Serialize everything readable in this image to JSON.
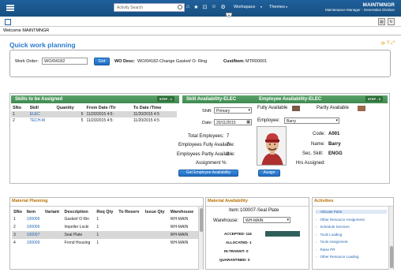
{
  "topbar": {
    "search_placeholder": "Activity Search",
    "nav_workspace": "Workspace",
    "nav_themes": "Themes",
    "user_name": "MAINTMNGR",
    "user_role": "Maintenance Manager - Generation Division"
  },
  "welcome": "Welcome MAINTMNGR",
  "page_title": "Quick work planning",
  "work_order": {
    "label": "Work Order:",
    "value": "WO/04182",
    "get_label": "Get",
    "desc_label": "WO Desc:",
    "desc_value": "WO/04182-Change Gasket/ O- Ring",
    "cust_label": "Cust/Item:",
    "cust_value": "MTR00001"
  },
  "skills": {
    "title": "Skills to be Assigned",
    "step": "STEP - 1",
    "columns": [
      "SNo",
      "Skill",
      "Quantity",
      "From Date /Tir",
      "To Date /Time"
    ],
    "rows": [
      [
        "1",
        "ELEC",
        "5",
        "11/20/2015 4:5:",
        "11/20/2015 4:5"
      ],
      [
        "2",
        "TECH-M",
        "5",
        "11/20/2015 4:5:",
        "11/20/2015 4:5"
      ]
    ]
  },
  "availability": {
    "title": "Skill Availability-ELEC",
    "step": "STEP - 2",
    "shift_label": "Shift:",
    "shift_value": "Primary",
    "date_label": "Date:",
    "date_value": "20/11/2015",
    "total_label": "Total Employees:",
    "total_value": "7",
    "full_label": "Employees Fully Available:",
    "full_value": "7",
    "partly_label": "Employees Partly Available:",
    "partly_value": "0",
    "assign_pct_label": "Assignment %:",
    "assign_pct_value": "",
    "button": "Get Employee Availability"
  },
  "employee": {
    "title": "Employee Availability-ELEC",
    "step": "STEP - 3",
    "fully_label": "Fully Available",
    "partly_label": "Partly Available",
    "employee_label": "Employee:",
    "employee_value": "Barry",
    "code_label": "Code:",
    "code_value": "A001",
    "name_label": "Name:",
    "name_value": "Barry",
    "sec_label": "Sec. Skill:",
    "sec_value": "ENGG",
    "hrs_label": "Hrs Assigned:",
    "hrs_value": "",
    "assign_button": "Assign"
  },
  "material_planning": {
    "title": "Material Planning",
    "columns": [
      "SNo",
      "Item",
      "Variant",
      "Description",
      "Req Qty",
      "To Reserv",
      "Issue Qty",
      "Warehouse"
    ],
    "rows": [
      [
        "1",
        "100006",
        "",
        "Gasket/ O Rin",
        "1",
        "",
        "",
        "WH-MAIN"
      ],
      [
        "2",
        "100006",
        "",
        "Impeller Locki",
        "1",
        "",
        "",
        "WH-MAIN"
      ],
      [
        "3",
        "100007",
        "",
        "Seal Plate",
        "1",
        "",
        "",
        "WH-MAIN"
      ],
      [
        "4",
        "100009",
        "",
        "Frond Housing",
        "1",
        "",
        "",
        "WH-MAIN"
      ]
    ]
  },
  "material_availability": {
    "title": "Material Availability",
    "item_label": "Item:",
    "item_value": "100007-Seal Plate",
    "warehouse_label": "Warehouse:",
    "warehouse_value": "WH-MAIN",
    "accepted_label": "ACCEPTED- 116",
    "accepted_fraction": 1.0,
    "allocated_label": "ALLOCATED- 1",
    "intransit_label": "IN-TRANSIT- 0",
    "quarantined_label": "QUARANTINED- 0"
  },
  "activities": {
    "title": "Activities",
    "items": [
      "Allocate Parts",
      "Other Resource Assignment",
      "Schedule Services",
      "Tools Loading",
      "Tools Assignment",
      "Raise PR",
      "Other Resource Loading"
    ]
  },
  "colors": {
    "accent": "#2a7ad0",
    "header_green": "#4a9a5c",
    "fully_swatch": "#7a5a48",
    "partly_swatch": "#9a6a4a",
    "bar": "#2f5f5a"
  }
}
